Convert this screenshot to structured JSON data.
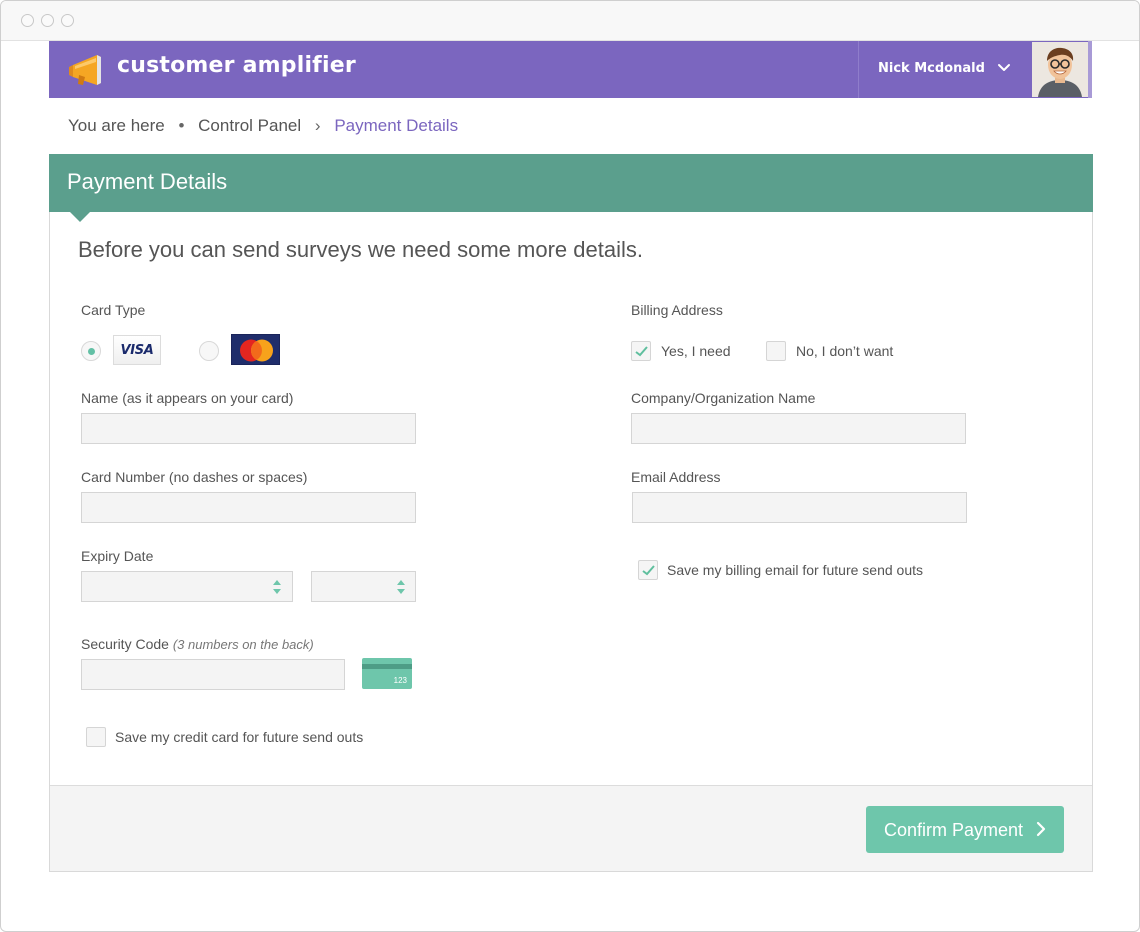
{
  "window": {},
  "header": {
    "brand": "customer amplifier",
    "user_name": "Nick Mcdonald",
    "accent_color": "#7b66bf"
  },
  "breadcrumb": {
    "prefix": "You are here",
    "separator_dot": "•",
    "parent": "Control Panel",
    "chevron": "›",
    "current": "Payment Details"
  },
  "panel": {
    "title": "Payment Details",
    "intro": "Before you can send surveys we need some more details.",
    "header_color": "#5b9f8d"
  },
  "left": {
    "card_type_label": "Card Type",
    "card_options": [
      {
        "name": "VISA",
        "selected": true
      },
      {
        "name": "MasterCard",
        "selected": false
      }
    ],
    "name_label": "Name (as it appears on your card)",
    "name_value": "",
    "card_number_label": "Card Number (no dashes or spaces)",
    "card_number_value": "",
    "expiry_label": "Expiry Date",
    "expiry_month_value": "",
    "expiry_year_value": "",
    "security_label": "Security Code",
    "security_hint": "(3 numbers on the back)",
    "security_value": "",
    "cvv_icon_text": "123",
    "save_card": {
      "label": "Save my credit card for future send outs",
      "checked": false
    }
  },
  "right": {
    "billing_label": "Billing Address",
    "billing_yes": {
      "label": "Yes, I need",
      "checked": true
    },
    "billing_no": {
      "label": "No, I don’t want",
      "checked": false
    },
    "company_label": "Company/Organization Name",
    "company_value": "",
    "email_label": "Email Address",
    "email_value": "",
    "save_email": {
      "label": "Save my billing email for future send outs",
      "checked": true
    }
  },
  "footer": {
    "confirm_label": "Confirm Payment",
    "confirm_color": "#6ec6ab"
  },
  "icons": {
    "logo": "megaphone-icon",
    "user_menu": "chevron-down-icon",
    "confirm": "chevron-right-icon",
    "checkmark": "checkmark-icon",
    "cvv": "credit-card-back-icon"
  }
}
